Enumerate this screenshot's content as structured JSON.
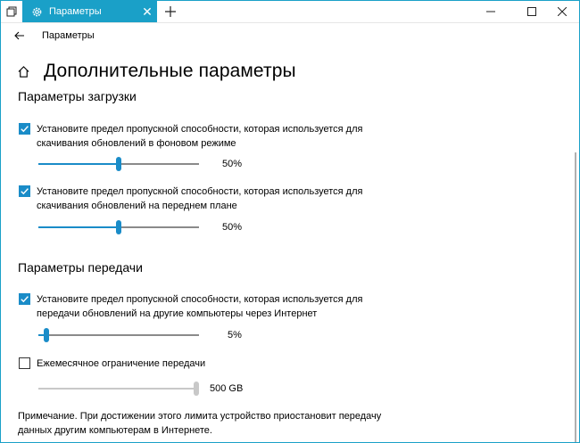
{
  "window": {
    "tab_title": "Параметры",
    "icons": {
      "tab_stack": "tab-stack-icon",
      "gear": "gear-icon",
      "close_tab": "close-icon",
      "new_tab": "plus-icon",
      "minimize": "minimize-icon",
      "maximize": "maximize-icon",
      "close": "close-icon"
    }
  },
  "nav": {
    "title": "Параметры",
    "back_icon": "back-arrow-icon"
  },
  "page": {
    "title": "Дополнительные параметры",
    "home_icon": "home-icon"
  },
  "download": {
    "title": "Параметры загрузки",
    "background": {
      "checked": true,
      "label": "Установите предел пропускной способности, которая используется для скачивания обновлений в фоновом режиме",
      "value_text": "50%",
      "value": 0.5
    },
    "foreground": {
      "checked": true,
      "label": "Установите предел пропускной способности, которая используется для скачивания обновлений на переднем плане",
      "value_text": "50%",
      "value": 0.5
    }
  },
  "upload": {
    "title": "Параметры передачи",
    "internet": {
      "checked": true,
      "label": "Установите предел пропускной способности, которая используется для передачи обновлений на другие компьютеры через Интернет",
      "value_text": "5%",
      "value": 0.05
    },
    "monthly": {
      "checked": false,
      "label": "Ежемесячное ограничение передачи",
      "value_text": "500 GB",
      "value": 1.0,
      "disabled": true
    },
    "note": "Примечание. При достижении этого лимита устройство приостановит передачу данных другим компьютерам в Интернете."
  },
  "colors": {
    "accent": "#1a8cc8",
    "title_tab": "#1aa0c8"
  }
}
